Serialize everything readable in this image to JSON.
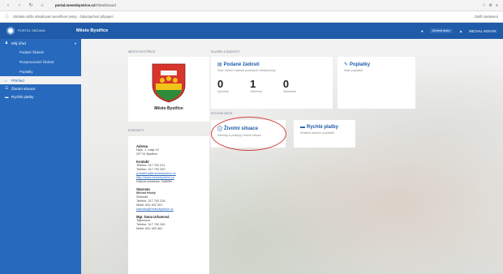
{
  "browser": {
    "url_host": "portal.mestobystrice.cz",
    "url_path": "/#/dashboard",
    "info_text": "Stránka může obsahovat neověřené prvky - Zabezpečení připojení",
    "info_right": "Další nastavení"
  },
  "app": {
    "logo_text": "PORTÁL OBČANA",
    "title": "Město Bystřice",
    "top_pill": "Změnit obec",
    "user": "MICHAL NOVÁK"
  },
  "sidebar": {
    "items": [
      {
        "label": "Můj úřad",
        "icon": "user-icon",
        "expanded": true
      },
      {
        "label": "Podané žádosti",
        "sub": true
      },
      {
        "label": "Rozpracované žádosti",
        "sub": true
      },
      {
        "label": "Poplatky",
        "sub": true
      },
      {
        "label": "Přehled",
        "icon": "home-icon",
        "active": true
      },
      {
        "label": "Životní situace",
        "icon": "list-icon"
      },
      {
        "label": "Rychlé platby",
        "icon": "card-icon"
      }
    ]
  },
  "main": {
    "label_town": "MĚSTO BYSTŘICE",
    "label_services": "SLUŽBY A ŽÁDOSTI",
    "label_contact": "KONTAKTY",
    "label_quick": "RYCHLÉ AKCE",
    "town_name": "Město Bystřice",
    "contact": {
      "address_head": "Adresa",
      "address_lines": [
        "Nám. 1. máje 10",
        "257 51 Bystřice"
      ],
      "contact_head": "Kontakt",
      "contact_lines": [
        "Telefon: 317 792 211",
        "Telefon: 317 792 200"
      ],
      "contact_links": [
        "podatelna@mestobystrice.cz",
        "http://www.mestobystrice.cz"
      ],
      "contact_note": "Datová schránka: 2a9b3tn",
      "mayor_head": "Starosta",
      "mayor_lines": [
        "Michal Hrubý",
        "Starosta",
        "Telefon: 317 792 218",
        "Mobil: 603 402 301"
      ],
      "mayor_link": "starosta@mestobystrice.cz",
      "clerk_head": "Mgr. Dana Urbanová",
      "clerk_lines": [
        "Tajemnice",
        "Telefon: 317 792 240",
        "Mobil: 602 403 361"
      ]
    },
    "requests_card": {
      "title": "Podané žádosti",
      "subtitle": "Stav Vašich žádostí podaných elektronicky",
      "counters": [
        {
          "value": "0",
          "label": "Vyřízené"
        },
        {
          "value": "1",
          "label": "Otevřené"
        },
        {
          "value": "0",
          "label": "Zamítnuté"
        }
      ]
    },
    "fees_card": {
      "title": "Poplatky",
      "subtitle": "Stav poplatků"
    },
    "life_card": {
      "title": "Životní situace",
      "subtitle": "Návody a postupy řešení situací"
    },
    "pay_card": {
      "title": "Rychlé platby",
      "subtitle": "Snadné placení poplatků"
    }
  },
  "colors": {
    "brand": "#1f5ba8",
    "sidebar": "#2669bd",
    "annotation": "#d3403c"
  }
}
